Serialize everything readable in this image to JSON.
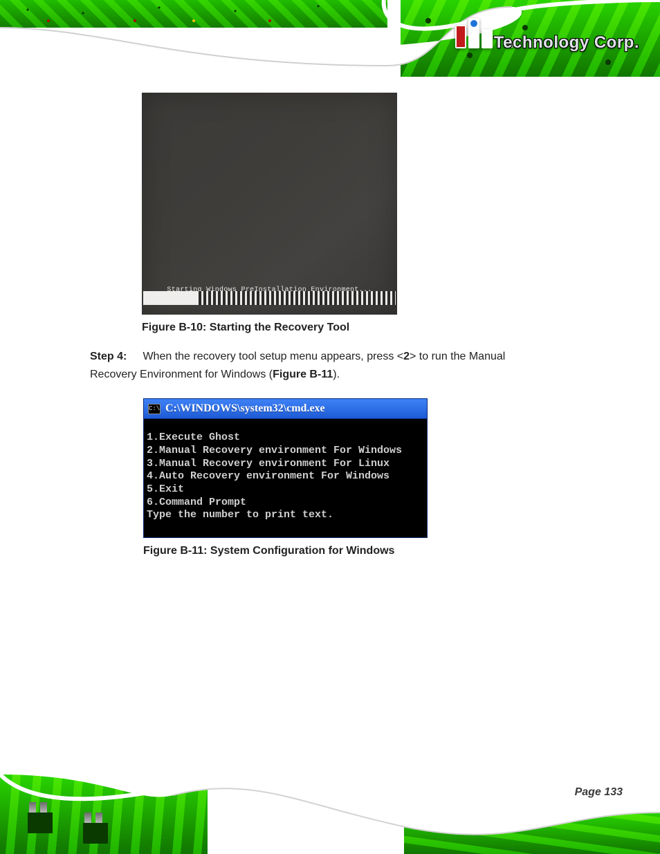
{
  "header": {
    "brand_text": "Technology Corp.",
    "registered_mark": "®"
  },
  "figure1": {
    "loading_text": "Starting Windows PreInstallation Environment...",
    "progress_percent": 22,
    "caption": "Figure B-10: Starting the Recovery Tool"
  },
  "step": {
    "label": "Step 4:",
    "text_before_fig": "When the recovery tool setup menu appears, press <",
    "key": "2",
    "text_after_key": "> to run the Manual Recovery Environment for Windows (",
    "fig_ref": "Figure B-11",
    "text_after_fig": ")."
  },
  "cmd": {
    "title": "C:\\WINDOWS\\system32\\cmd.exe",
    "icon_text": "C:\\",
    "lines": [
      "1.Execute Ghost",
      "2.Manual Recovery environment For Windows",
      "3.Manual Recovery environment For Linux",
      "4.Auto Recovery environment For Windows",
      "5.Exit",
      "6.Command Prompt",
      "Type the number to print text."
    ]
  },
  "figure2_caption": "Figure B-11: System Configuration for Windows",
  "footer": {
    "page_label": "Page 133"
  }
}
